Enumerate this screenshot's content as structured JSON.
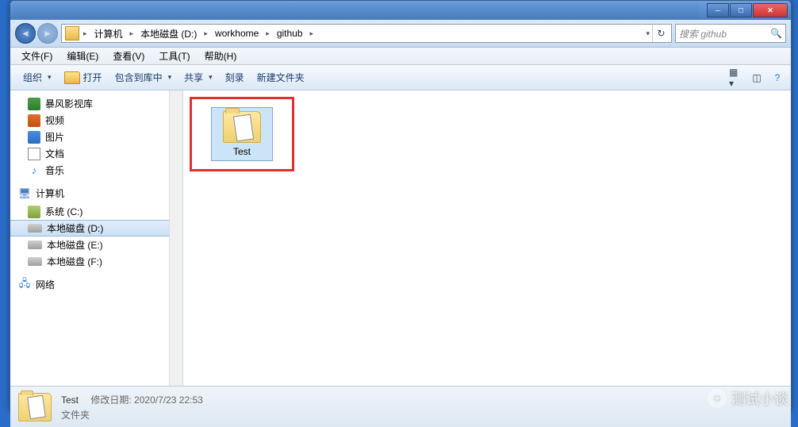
{
  "breadcrumb": {
    "segments": [
      "计算机",
      "本地磁盘 (D:)",
      "workhome",
      "github"
    ]
  },
  "search": {
    "placeholder": "搜索 github"
  },
  "menubar": {
    "file": "文件(F)",
    "edit": "编辑(E)",
    "view": "查看(V)",
    "tools": "工具(T)",
    "help": "帮助(H)"
  },
  "toolbar": {
    "organize": "组织",
    "open": "打开",
    "include": "包含到库中",
    "share": "共享",
    "burn": "刻录",
    "newfolder": "新建文件夹"
  },
  "sidebar": {
    "libs": {
      "storm": "暴风影视库",
      "video": "视频",
      "pictures": "图片",
      "documents": "文档",
      "music": "音乐"
    },
    "computer": {
      "label": "计算机",
      "c": "系统 (C:)",
      "d": "本地磁盘 (D:)",
      "e": "本地磁盘 (E:)",
      "f": "本地磁盘 (F:)"
    },
    "network": "网络"
  },
  "content": {
    "folder_name": "Test"
  },
  "statusbar": {
    "name": "Test",
    "date_label": "修改日期:",
    "date_value": "2020/7/23 22:53",
    "type": "文件夹"
  },
  "watermark": "测试小谈"
}
